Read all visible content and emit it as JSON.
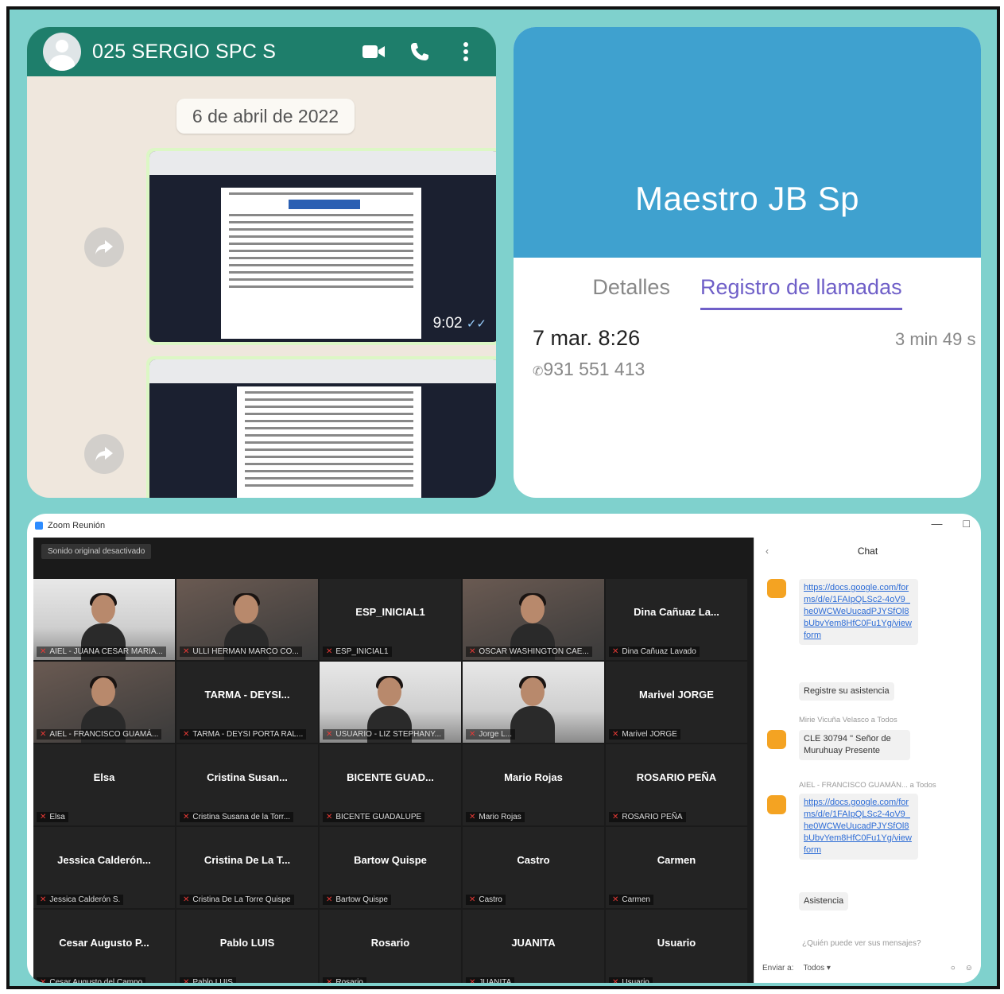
{
  "whatsapp": {
    "contact_name": "025 SERGIO SPC S",
    "date_chip": "6 de abril de 2022",
    "msg_time": "9:02",
    "read_ticks": "✓✓"
  },
  "contact": {
    "name": "Maestro JB Sp",
    "tabs": [
      "Detalles",
      "Registro de llamadas"
    ],
    "call_datetime": "7 mar. 8:26",
    "call_number": "931 551 413",
    "call_duration": "3 min 49 s"
  },
  "zoom": {
    "window_title": "Zoom Reunión",
    "original_sound_button": "Sonido original desactivado",
    "chat_title": "Chat",
    "tiles": [
      {
        "big": "",
        "label": "AIEL - JUANA CESAR MARIA...",
        "video": true
      },
      {
        "big": "",
        "label": "ULLI HERMAN MARCO CO...",
        "video": true
      },
      {
        "big": "ESP_INICIAL1",
        "label": "ESP_INICIAL1",
        "video": false
      },
      {
        "big": "",
        "label": "OSCAR WASHINGTON CAE...",
        "video": true
      },
      {
        "big": "Dina Cañuaz La...",
        "label": "Dina Cañuaz Lavado",
        "video": false
      },
      {
        "big": "",
        "label": "AIEL - FRANCISCO GUAMÁ...",
        "video": true
      },
      {
        "big": "TARMA - DEYSI...",
        "label": "TARMA - DEYSI PORTA RAL...",
        "video": false
      },
      {
        "big": "",
        "label": "USUARIO - LIZ STEPHANY...",
        "video": true
      },
      {
        "big": "",
        "label": "Jorge L...",
        "video": true
      },
      {
        "big": "Marivel JORGE",
        "label": "Marivel JORGE",
        "video": false
      },
      {
        "big": "Elsa",
        "label": "Elsa",
        "video": false
      },
      {
        "big": "Cristina Susan...",
        "label": "Cristina Susana de la Torr...",
        "video": false
      },
      {
        "big": "BICENTE GUAD...",
        "label": "BICENTE GUADALUPE",
        "video": false
      },
      {
        "big": "Mario Rojas",
        "label": "Mario Rojas",
        "video": false
      },
      {
        "big": "ROSARIO PEÑA",
        "label": "ROSARIO PEÑA",
        "video": false
      },
      {
        "big": "Jessica Calderón...",
        "label": "Jessica Calderón S.",
        "video": false
      },
      {
        "big": "Cristina De La T...",
        "label": "Cristina De La Torre Quispe",
        "video": false
      },
      {
        "big": "Bartow Quispe",
        "label": "Bartow Quispe",
        "video": false
      },
      {
        "big": "Castro",
        "label": "Castro",
        "video": false
      },
      {
        "big": "Carmen",
        "label": "Carmen",
        "video": false
      },
      {
        "big": "Cesar Augusto P...",
        "label": "Cesar Augusto del Campo",
        "video": false
      },
      {
        "big": "Pablo LUIS",
        "label": "Pablo LUIS",
        "video": false
      },
      {
        "big": "Rosario",
        "label": "Rosario",
        "video": false
      },
      {
        "big": "JUANITA",
        "label": "JUANITA",
        "video": false
      },
      {
        "big": "Usuario",
        "label": "Usuario",
        "video": false
      }
    ],
    "chat": {
      "msg1_link": "https://docs.google.com/forms/d/e/1FAIpQLSc2-4oV9_he0WCWeUucadPJYSfOl8bUbvYem8HfC0Fu1Yg/viewform",
      "msg1_text": "Registre su asistencia",
      "msg2_sender": "Mirie Vicuña Velasco a Todos",
      "msg2_text": "CLE 30794 \" Señor de Muruhuay Presente",
      "msg3_sender": "AIEL - FRANCISCO GUAMÁN... a Todos",
      "msg3_link": "https://docs.google.com/forms/d/e/1FAIpQLSc2-4oV9_he0WCWeUucadPJYSfOl8bUbvYem8HfC0Fu1Yg/viewform",
      "msg3_text": "Asistencia",
      "placeholder": "¿Quién puede ver sus mensajes?",
      "send_to_label": "Enviar a:",
      "send_to_value": "Todos"
    }
  }
}
